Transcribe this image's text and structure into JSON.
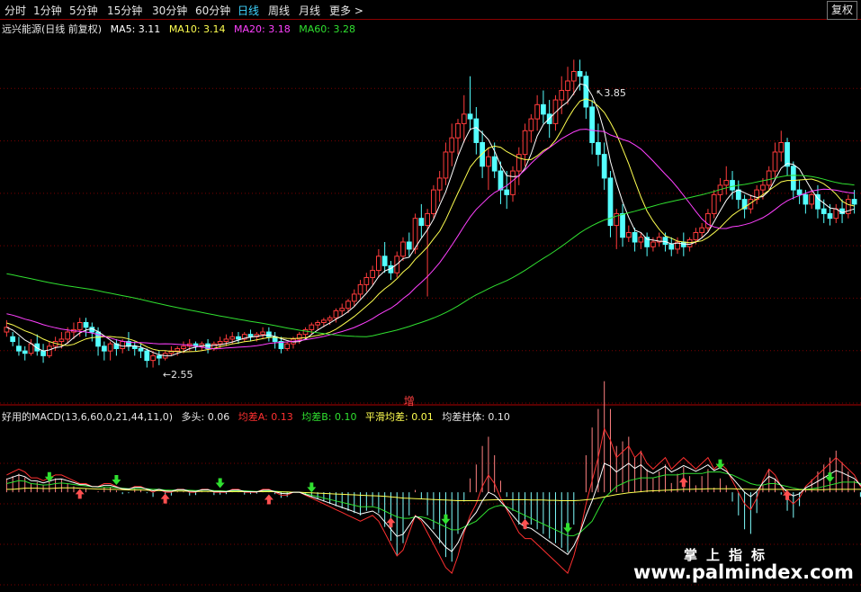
{
  "tabs": [
    "分时",
    "1分钟",
    "5分钟",
    "15分钟",
    "30分钟",
    "60分钟",
    "日线",
    "周线",
    "月线",
    "更多 >"
  ],
  "active_tab": "日线",
  "fuquan_button": "复权",
  "main_legend": {
    "title": "远兴能源(日线 前复权)",
    "ma5": "MA5: 3.11",
    "ma10": "MA10: 3.14",
    "ma20": "MA20: 3.18",
    "ma60": "MA60: 3.28"
  },
  "sub_legend": {
    "title": "好用的MACD(13,6,60,0,21,44,11,0)",
    "duotou": "多头: 0.06",
    "a": "均差A: 0.13",
    "b": "均差B: 0.10",
    "smooth": "平滑均差: 0.01",
    "bar": "均差柱体: 0.10"
  },
  "signal_text": "增",
  "watermark": {
    "line1": "掌上指标",
    "line2": "www.palmindex.com"
  },
  "colors": {
    "up": "#ff3c3c",
    "down": "#54ffff",
    "ma5": "#ffffff",
    "ma10": "#ffff50",
    "ma20": "#ff40ff",
    "ma60": "#30e030",
    "grid": "#7a0000",
    "arrow_up": "#ff5050",
    "arrow_down": "#30e030",
    "a": "#ff3030",
    "b": "#30e030",
    "smooth": "#ffff50",
    "bar": "#ffffff"
  },
  "chart_data": [
    {
      "type": "candlestick",
      "title": "远兴能源(日线 前复权)",
      "ylim": [
        2.4,
        3.95
      ],
      "annotations": [
        {
          "label": "3.85",
          "index": 96
        },
        {
          "label": "2.55",
          "index": 25
        }
      ],
      "candles": [
        [
          2.7,
          2.75,
          2.72,
          2.68
        ],
        [
          2.68,
          2.7,
          2.66,
          2.64
        ],
        [
          2.64,
          2.68,
          2.62,
          2.6
        ],
        [
          2.62,
          2.64,
          2.61,
          2.58
        ],
        [
          2.61,
          2.67,
          2.65,
          2.6
        ],
        [
          2.65,
          2.69,
          2.62,
          2.6
        ],
        [
          2.62,
          2.65,
          2.6,
          2.57
        ],
        [
          2.6,
          2.66,
          2.64,
          2.59
        ],
        [
          2.64,
          2.68,
          2.66,
          2.62
        ],
        [
          2.66,
          2.7,
          2.67,
          2.63
        ],
        [
          2.67,
          2.72,
          2.7,
          2.65
        ],
        [
          2.7,
          2.74,
          2.71,
          2.67
        ],
        [
          2.71,
          2.76,
          2.74,
          2.68
        ],
        [
          2.74,
          2.76,
          2.72,
          2.68
        ],
        [
          2.72,
          2.74,
          2.7,
          2.66
        ],
        [
          2.7,
          2.72,
          2.64,
          2.6
        ],
        [
          2.64,
          2.66,
          2.62,
          2.58
        ],
        [
          2.62,
          2.66,
          2.65,
          2.58
        ],
        [
          2.65,
          2.67,
          2.63,
          2.6
        ],
        [
          2.63,
          2.67,
          2.66,
          2.61
        ],
        [
          2.66,
          2.7,
          2.64,
          2.62
        ],
        [
          2.64,
          2.66,
          2.63,
          2.6
        ],
        [
          2.63,
          2.65,
          2.62,
          2.59
        ],
        [
          2.62,
          2.63,
          2.58,
          2.55
        ],
        [
          2.58,
          2.62,
          2.6,
          2.55
        ],
        [
          2.6,
          2.62,
          2.59,
          2.56
        ],
        [
          2.59,
          2.62,
          2.61,
          2.58
        ],
        [
          2.61,
          2.64,
          2.62,
          2.6
        ],
        [
          2.62,
          2.64,
          2.63,
          2.6
        ],
        [
          2.63,
          2.66,
          2.64,
          2.61
        ],
        [
          2.64,
          2.67,
          2.65,
          2.62
        ],
        [
          2.65,
          2.66,
          2.64,
          2.62
        ],
        [
          2.64,
          2.66,
          2.65,
          2.62
        ],
        [
          2.65,
          2.67,
          2.63,
          2.61
        ],
        [
          2.63,
          2.66,
          2.65,
          2.62
        ],
        [
          2.65,
          2.68,
          2.66,
          2.63
        ],
        [
          2.66,
          2.69,
          2.67,
          2.64
        ],
        [
          2.67,
          2.7,
          2.68,
          2.65
        ],
        [
          2.68,
          2.7,
          2.67,
          2.65
        ],
        [
          2.67,
          2.7,
          2.69,
          2.66
        ],
        [
          2.69,
          2.71,
          2.68,
          2.66
        ],
        [
          2.68,
          2.7,
          2.69,
          2.66
        ],
        [
          2.69,
          2.72,
          2.7,
          2.67
        ],
        [
          2.7,
          2.72,
          2.68,
          2.66
        ],
        [
          2.68,
          2.7,
          2.66,
          2.63
        ],
        [
          2.66,
          2.68,
          2.63,
          2.61
        ],
        [
          2.63,
          2.66,
          2.65,
          2.62
        ],
        [
          2.65,
          2.68,
          2.67,
          2.63
        ],
        [
          2.67,
          2.7,
          2.69,
          2.65
        ],
        [
          2.69,
          2.72,
          2.71,
          2.67
        ],
        [
          2.71,
          2.74,
          2.73,
          2.69
        ],
        [
          2.73,
          2.75,
          2.74,
          2.71
        ],
        [
          2.74,
          2.76,
          2.75,
          2.72
        ],
        [
          2.75,
          2.77,
          2.76,
          2.73
        ],
        [
          2.76,
          2.8,
          2.79,
          2.74
        ],
        [
          2.79,
          2.82,
          2.8,
          2.77
        ],
        [
          2.8,
          2.84,
          2.83,
          2.78
        ],
        [
          2.83,
          2.88,
          2.86,
          2.81
        ],
        [
          2.86,
          2.92,
          2.9,
          2.84
        ],
        [
          2.9,
          2.95,
          2.93,
          2.87
        ],
        [
          2.93,
          2.98,
          2.96,
          2.9
        ],
        [
          2.96,
          3.05,
          3.02,
          2.93
        ],
        [
          3.02,
          3.08,
          2.98,
          2.95
        ],
        [
          2.98,
          3.0,
          2.95,
          2.92
        ],
        [
          2.95,
          3.04,
          3.02,
          2.93
        ],
        [
          3.02,
          3.1,
          3.08,
          3.0
        ],
        [
          3.08,
          3.12,
          3.05,
          3.02
        ],
        [
          3.05,
          3.2,
          3.18,
          3.03
        ],
        [
          3.18,
          3.24,
          3.15,
          3.1
        ],
        [
          3.15,
          3.22,
          3.2,
          2.85
        ],
        [
          3.2,
          3.32,
          3.3,
          3.18
        ],
        [
          3.3,
          3.38,
          3.35,
          3.25
        ],
        [
          3.35,
          3.5,
          3.46,
          3.32
        ],
        [
          3.46,
          3.58,
          3.52,
          3.4
        ],
        [
          3.52,
          3.6,
          3.58,
          3.45
        ],
        [
          3.58,
          3.7,
          3.62,
          3.5
        ],
        [
          3.62,
          3.78,
          3.6,
          3.55
        ],
        [
          3.6,
          3.65,
          3.5,
          3.45
        ],
        [
          3.5,
          3.55,
          3.4,
          3.35
        ],
        [
          3.4,
          3.48,
          3.44,
          3.3
        ],
        [
          3.44,
          3.5,
          3.38,
          3.35
        ],
        [
          3.38,
          3.42,
          3.3,
          3.24
        ],
        [
          3.3,
          3.38,
          3.28,
          3.22
        ],
        [
          3.28,
          3.4,
          3.38,
          3.25
        ],
        [
          3.38,
          3.48,
          3.45,
          3.32
        ],
        [
          3.45,
          3.58,
          3.55,
          3.4
        ],
        [
          3.55,
          3.62,
          3.6,
          3.5
        ],
        [
          3.6,
          3.7,
          3.66,
          3.55
        ],
        [
          3.66,
          3.72,
          3.62,
          3.58
        ],
        [
          3.62,
          3.68,
          3.58,
          3.52
        ],
        [
          3.58,
          3.7,
          3.68,
          3.55
        ],
        [
          3.68,
          3.78,
          3.72,
          3.62
        ],
        [
          3.72,
          3.82,
          3.76,
          3.66
        ],
        [
          3.76,
          3.85,
          3.8,
          3.7
        ],
        [
          3.8,
          3.85,
          3.78,
          3.72
        ],
        [
          3.78,
          3.8,
          3.65,
          3.6
        ],
        [
          3.65,
          3.68,
          3.5,
          3.45
        ],
        [
          3.5,
          3.58,
          3.45,
          3.4
        ],
        [
          3.45,
          3.5,
          3.35,
          3.3
        ],
        [
          3.35,
          3.38,
          3.15,
          3.1
        ],
        [
          3.15,
          3.22,
          3.2,
          3.05
        ],
        [
          3.2,
          3.24,
          3.1,
          3.06
        ],
        [
          3.1,
          3.15,
          3.12,
          3.08
        ],
        [
          3.12,
          3.14,
          3.08,
          3.04
        ],
        [
          3.08,
          3.12,
          3.1,
          3.05
        ],
        [
          3.1,
          3.12,
          3.06,
          3.02
        ],
        [
          3.06,
          3.1,
          3.08,
          3.04
        ],
        [
          3.08,
          3.12,
          3.1,
          3.06
        ],
        [
          3.1,
          3.12,
          3.07,
          3.04
        ],
        [
          3.07,
          3.1,
          3.05,
          3.02
        ],
        [
          3.05,
          3.1,
          3.08,
          3.03
        ],
        [
          3.08,
          3.12,
          3.06,
          3.02
        ],
        [
          3.06,
          3.1,
          3.09,
          3.04
        ],
        [
          3.09,
          3.14,
          3.12,
          3.07
        ],
        [
          3.12,
          3.16,
          3.14,
          3.1
        ],
        [
          3.14,
          3.22,
          3.2,
          3.12
        ],
        [
          3.2,
          3.3,
          3.28,
          3.18
        ],
        [
          3.28,
          3.35,
          3.32,
          3.25
        ],
        [
          3.32,
          3.4,
          3.34,
          3.28
        ],
        [
          3.34,
          3.38,
          3.3,
          3.26
        ],
        [
          3.3,
          3.34,
          3.26,
          3.22
        ],
        [
          3.26,
          3.28,
          3.22,
          3.18
        ],
        [
          3.22,
          3.28,
          3.26,
          3.2
        ],
        [
          3.26,
          3.32,
          3.3,
          3.24
        ],
        [
          3.3,
          3.35,
          3.32,
          3.26
        ],
        [
          3.32,
          3.4,
          3.38,
          3.3
        ],
        [
          3.38,
          3.5,
          3.46,
          3.35
        ],
        [
          3.46,
          3.55,
          3.5,
          3.42
        ],
        [
          3.5,
          3.52,
          3.4,
          3.36
        ],
        [
          3.4,
          3.42,
          3.3,
          3.26
        ],
        [
          3.3,
          3.34,
          3.28,
          3.24
        ],
        [
          3.28,
          3.3,
          3.24,
          3.2
        ],
        [
          3.24,
          3.3,
          3.28,
          3.22
        ],
        [
          3.28,
          3.32,
          3.22,
          3.18
        ],
        [
          3.22,
          3.26,
          3.2,
          3.16
        ],
        [
          3.2,
          3.24,
          3.18,
          3.15
        ],
        [
          3.18,
          3.24,
          3.22,
          3.16
        ],
        [
          3.22,
          3.26,
          3.2,
          3.16
        ],
        [
          3.2,
          3.28,
          3.26,
          3.18
        ],
        [
          3.26,
          3.3,
          3.24,
          3.2
        ]
      ]
    },
    {
      "type": "line",
      "title": "好用的MACD(13,6,60,0,21,44,11,0)",
      "series": [
        {
          "name": "均差A"
        },
        {
          "name": "均差B"
        },
        {
          "name": "平滑均差"
        },
        {
          "name": "均差柱体"
        }
      ],
      "ylim": [
        -0.32,
        0.24
      ],
      "a": [
        0.06,
        0.07,
        0.08,
        0.07,
        0.05,
        0.05,
        0.04,
        0.05,
        0.06,
        0.06,
        0.05,
        0.04,
        0.03,
        0.03,
        0.02,
        0.02,
        0.03,
        0.03,
        0.02,
        0.01,
        0.01,
        0.02,
        0.02,
        0.01,
        0.0,
        0.01,
        0.0,
        0.0,
        0.01,
        0.01,
        0.0,
        0.0,
        0.01,
        0.01,
        0.0,
        0.0,
        0.0,
        0.01,
        0.01,
        0.0,
        0.0,
        0.0,
        0.01,
        0.01,
        0.0,
        -0.01,
        -0.01,
        0.0,
        0.0,
        -0.01,
        -0.02,
        -0.03,
        -0.04,
        -0.05,
        -0.06,
        -0.07,
        -0.08,
        -0.09,
        -0.1,
        -0.09,
        -0.08,
        -0.1,
        -0.14,
        -0.18,
        -0.22,
        -0.2,
        -0.14,
        -0.08,
        -0.1,
        -0.14,
        -0.18,
        -0.22,
        -0.26,
        -0.28,
        -0.22,
        -0.14,
        -0.08,
        -0.04,
        0.02,
        0.06,
        0.03,
        -0.02,
        -0.06,
        -0.1,
        -0.14,
        -0.16,
        -0.16,
        -0.18,
        -0.2,
        -0.22,
        -0.24,
        -0.26,
        -0.28,
        -0.22,
        -0.14,
        -0.04,
        0.04,
        0.12,
        0.22,
        0.18,
        0.12,
        0.14,
        0.16,
        0.12,
        0.14,
        0.1,
        0.08,
        0.1,
        0.12,
        0.08,
        0.1,
        0.12,
        0.1,
        0.08,
        0.1,
        0.12,
        0.08,
        0.1,
        0.08,
        0.04,
        0.0,
        -0.04,
        -0.06,
        -0.02,
        0.04,
        0.08,
        0.06,
        0.02,
        -0.02,
        -0.04,
        -0.02,
        0.02,
        0.04,
        0.06,
        0.08,
        0.1,
        0.12,
        0.1,
        0.08,
        0.06,
        0.02,
        0.0,
        0.02
      ],
      "b": [
        0.03,
        0.035,
        0.04,
        0.038,
        0.03,
        0.028,
        0.025,
        0.026,
        0.03,
        0.032,
        0.03,
        0.027,
        0.024,
        0.022,
        0.02,
        0.018,
        0.018,
        0.018,
        0.016,
        0.014,
        0.012,
        0.013,
        0.014,
        0.012,
        0.01,
        0.01,
        0.008,
        0.007,
        0.008,
        0.008,
        0.007,
        0.006,
        0.007,
        0.008,
        0.006,
        0.005,
        0.004,
        0.005,
        0.006,
        0.005,
        0.004,
        0.003,
        0.004,
        0.005,
        0.004,
        0.002,
        0.0,
        0.0,
        0.0,
        -0.005,
        -0.01,
        -0.015,
        -0.02,
        -0.025,
        -0.03,
        -0.035,
        -0.04,
        -0.045,
        -0.05,
        -0.05,
        -0.05,
        -0.055,
        -0.065,
        -0.075,
        -0.085,
        -0.09,
        -0.09,
        -0.085,
        -0.085,
        -0.09,
        -0.1,
        -0.11,
        -0.12,
        -0.13,
        -0.13,
        -0.12,
        -0.11,
        -0.1,
        -0.08,
        -0.06,
        -0.05,
        -0.045,
        -0.05,
        -0.06,
        -0.07,
        -0.08,
        -0.09,
        -0.1,
        -0.11,
        -0.12,
        -0.13,
        -0.14,
        -0.15,
        -0.15,
        -0.14,
        -0.12,
        -0.1,
        -0.06,
        -0.02,
        0.0,
        0.02,
        0.03,
        0.04,
        0.045,
        0.05,
        0.05,
        0.05,
        0.055,
        0.06,
        0.06,
        0.06,
        0.065,
        0.065,
        0.065,
        0.065,
        0.07,
        0.07,
        0.07,
        0.065,
        0.06,
        0.05,
        0.04,
        0.03,
        0.025,
        0.025,
        0.03,
        0.03,
        0.025,
        0.02,
        0.015,
        0.01,
        0.01,
        0.012,
        0.015,
        0.02,
        0.025,
        0.03,
        0.035,
        0.035,
        0.035,
        0.03,
        0.025,
        0.025
      ],
      "smooth": [
        0.01,
        0.01,
        0.012,
        0.014,
        0.014,
        0.014,
        0.013,
        0.013,
        0.014,
        0.015,
        0.015,
        0.015,
        0.014,
        0.013,
        0.012,
        0.011,
        0.011,
        0.01,
        0.01,
        0.009,
        0.008,
        0.008,
        0.008,
        0.007,
        0.006,
        0.006,
        0.005,
        0.004,
        0.004,
        0.004,
        0.004,
        0.003,
        0.003,
        0.003,
        0.003,
        0.003,
        0.002,
        0.002,
        0.002,
        0.002,
        0.002,
        0.002,
        0.002,
        0.002,
        0.002,
        0.001,
        0.001,
        0.0,
        0.0,
        -0.001,
        -0.002,
        -0.003,
        -0.004,
        -0.005,
        -0.006,
        -0.007,
        -0.008,
        -0.009,
        -0.01,
        -0.011,
        -0.012,
        -0.013,
        -0.014,
        -0.016,
        -0.018,
        -0.02,
        -0.021,
        -0.022,
        -0.023,
        -0.024,
        -0.025,
        -0.026,
        -0.027,
        -0.028,
        -0.029,
        -0.029,
        -0.029,
        -0.029,
        -0.028,
        -0.027,
        -0.026,
        -0.026,
        -0.026,
        -0.026,
        -0.026,
        -0.026,
        -0.027,
        -0.027,
        -0.027,
        -0.028,
        -0.028,
        -0.029,
        -0.029,
        -0.029,
        -0.028,
        -0.026,
        -0.024,
        -0.02,
        -0.016,
        -0.012,
        -0.008,
        -0.005,
        -0.002,
        0.0,
        0.002,
        0.004,
        0.005,
        0.006,
        0.007,
        0.008,
        0.009,
        0.01,
        0.01,
        0.011,
        0.011,
        0.012,
        0.012,
        0.012,
        0.012,
        0.012,
        0.011,
        0.011,
        0.01,
        0.01,
        0.01,
        0.01,
        0.01,
        0.01,
        0.009,
        0.009,
        0.009,
        0.009,
        0.009,
        0.009,
        0.009,
        0.01,
        0.01,
        0.01,
        0.01,
        0.01,
        0.01,
        0.01,
        0.01
      ],
      "up_arrows": [
        12,
        26,
        43,
        63,
        85,
        111,
        128,
        142
      ],
      "down_arrows": [
        7,
        18,
        35,
        50,
        72,
        92,
        117,
        135
      ]
    }
  ]
}
